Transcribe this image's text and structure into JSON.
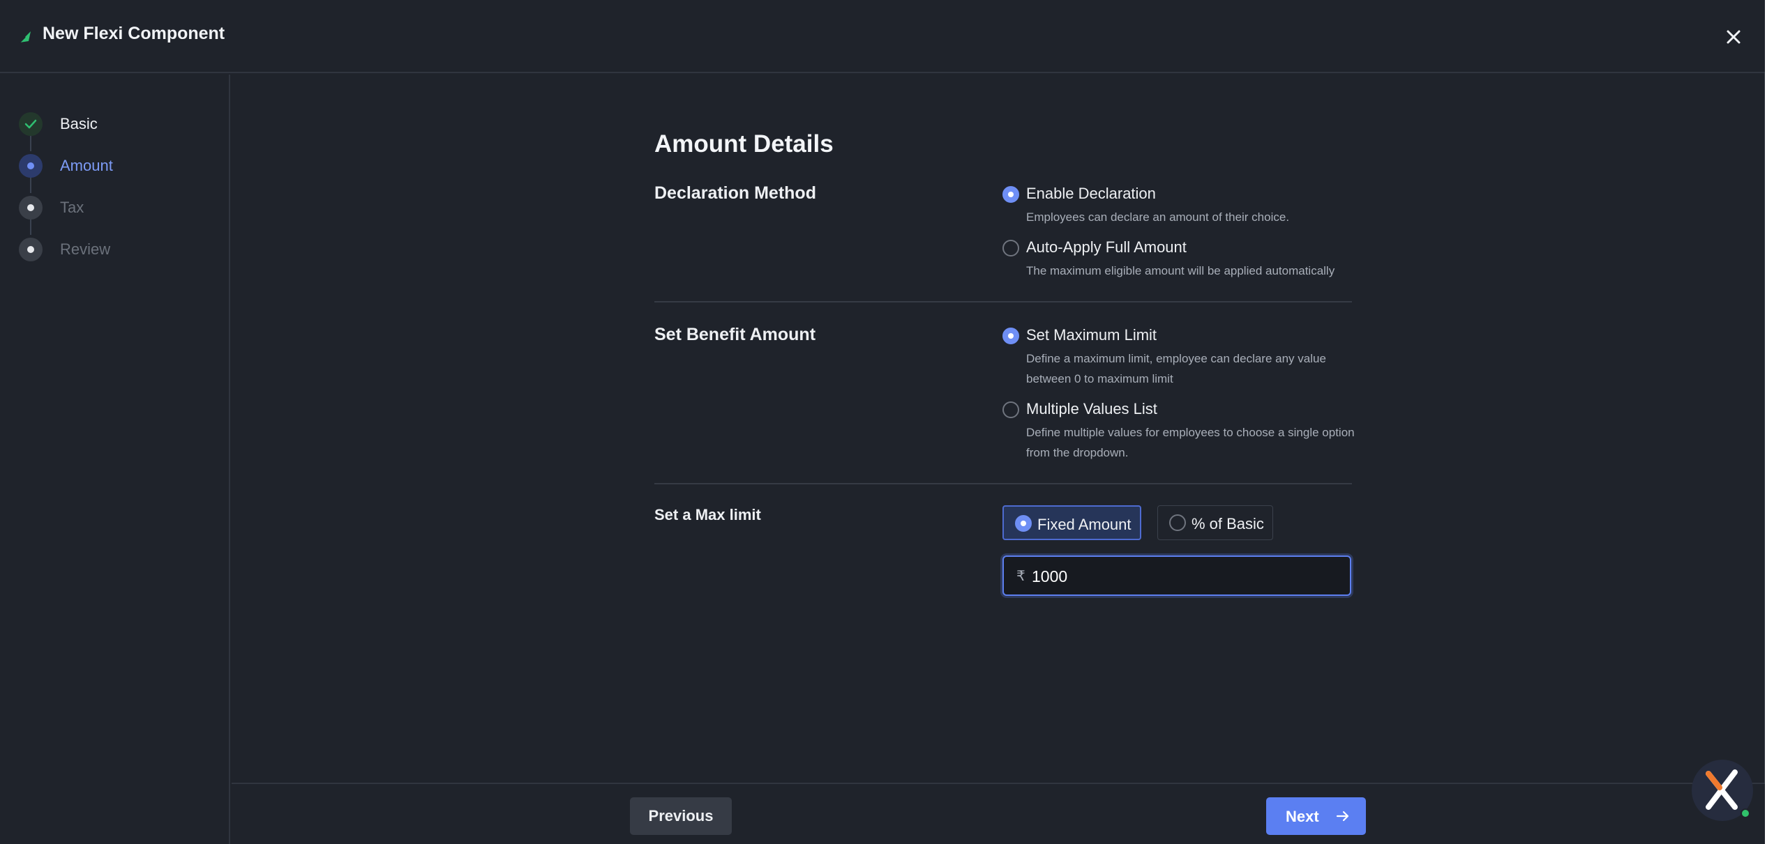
{
  "header": {
    "title": "New Flexi Component",
    "logo_icon": "leaf-icon",
    "close_icon": "close-icon"
  },
  "sidebar": {
    "steps": [
      {
        "label": "Basic",
        "state": "done"
      },
      {
        "label": "Amount",
        "state": "active"
      },
      {
        "label": "Tax",
        "state": "pending"
      },
      {
        "label": "Review",
        "state": "pending"
      }
    ]
  },
  "main": {
    "title": "Amount Details",
    "declaration": {
      "label": "Declaration Method",
      "options": [
        {
          "title": "Enable Declaration",
          "desc": "Employees can declare an amount of their choice.",
          "checked": true
        },
        {
          "title": "Auto-Apply Full Amount",
          "desc": "The maximum eligible amount will be applied automatically",
          "checked": false
        }
      ]
    },
    "benefit": {
      "label": "Set Benefit Amount",
      "options": [
        {
          "title": "Set Maximum Limit",
          "desc": "Define a maximum limit, employee can declare any value between 0 to maximum limit",
          "checked": true
        },
        {
          "title": "Multiple Values List",
          "desc": "Define multiple values for employees to choose a single option from the dropdown.",
          "checked": false
        }
      ]
    },
    "max_limit": {
      "label": "Set a Max limit",
      "options": [
        {
          "label": "Fixed Amount",
          "checked": true
        },
        {
          "label": "% of Basic",
          "checked": false
        }
      ],
      "currency": "₹",
      "value": "1000"
    }
  },
  "footer": {
    "previous_label": "Previous",
    "next_label": "Next"
  },
  "colors": {
    "accent": "#5b7ff2",
    "background": "#1f232b",
    "success": "#2fbf71"
  }
}
